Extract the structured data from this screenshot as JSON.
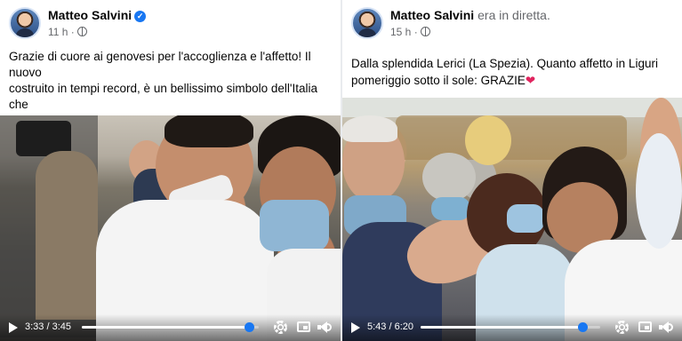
{
  "posts": [
    {
      "author": "Matteo Salvini",
      "status": "",
      "verified": true,
      "time": "11 h ·",
      "text": "Grazie di cuore ai genovesi per l'accoglienza e l'affetto! Il nuovo\ncostruito in tempi record, è un bellissimo simbolo dell'Italia che\nrialza. Dico a Conte che le chiacchiere stanno a zero: applichi su\nModello Genova a tutta Italia.",
      "video": {
        "current": "3:33",
        "separator": "/",
        "duration": "3:45",
        "progress": 0.947
      }
    },
    {
      "author": "Matteo Salvini",
      "status": "era in diretta.",
      "verified": false,
      "time": "15 h ·",
      "text": "Dalla splendida Lerici (La Spezia). Quanto affetto in Liguri\npomeriggio sotto il sole: GRAZIE",
      "emoji": "❤",
      "video": {
        "current": "5:43",
        "separator": "/",
        "duration": "6:20",
        "progress": 0.903
      }
    }
  ],
  "icons": [
    "avatar",
    "verified-badge-icon",
    "globe-icon",
    "play-icon",
    "gear-icon",
    "pip-icon",
    "volume-icon"
  ],
  "colors": {
    "facebook_blue": "#1877f2",
    "text": "#050505",
    "secondary_text": "#65676b",
    "heart": "#e0245e"
  }
}
